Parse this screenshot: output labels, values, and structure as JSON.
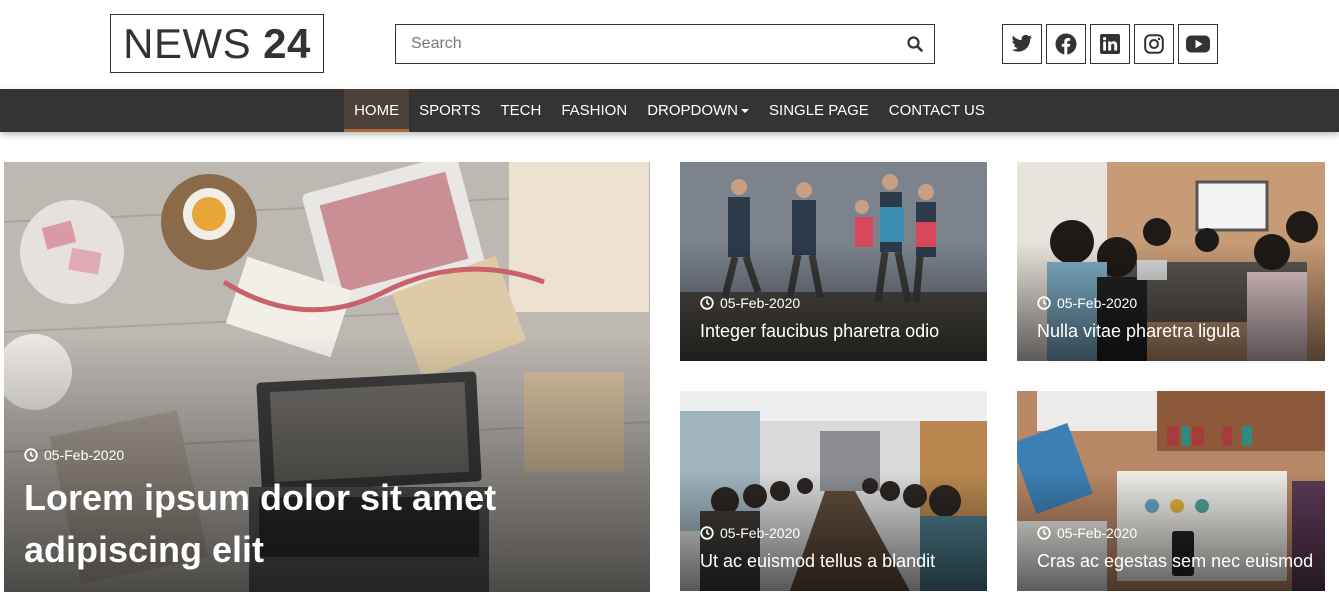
{
  "logo": {
    "light": "NEWS",
    "bold": "24"
  },
  "search": {
    "placeholder": "Search",
    "icon": "search-icon"
  },
  "social": [
    {
      "name": "twitter",
      "icon": "twitter-icon"
    },
    {
      "name": "facebook",
      "icon": "facebook-icon"
    },
    {
      "name": "linkedin",
      "icon": "linkedin-icon"
    },
    {
      "name": "instagram",
      "icon": "instagram-icon"
    },
    {
      "name": "youtube",
      "icon": "youtube-icon"
    }
  ],
  "nav": {
    "items": [
      "HOME",
      "SPORTS",
      "TECH",
      "FASHION",
      "DROPDOWN",
      "SINGLE PAGE",
      "CONTACT US"
    ],
    "active": "HOME"
  },
  "featured": {
    "date": "05-Feb-2020",
    "title_line1": "Lorem ipsum dolor sit amet",
    "title_line2": "adipiscing elit"
  },
  "cards": [
    {
      "date": "05-Feb-2020",
      "title": "Integer faucibus pharetra odio"
    },
    {
      "date": "05-Feb-2020",
      "title": "Nulla vitae pharetra ligula"
    },
    {
      "date": "05-Feb-2020",
      "title": "Ut ac euismod tellus a blandit"
    },
    {
      "date": "05-Feb-2020",
      "title": "Cras ac egestas sem nec euismod"
    }
  ],
  "colors": {
    "nav_bg": "#343434",
    "nav_active_bg": "#4d4038",
    "nav_active_border": "#a86b3c",
    "border": "#333333"
  }
}
